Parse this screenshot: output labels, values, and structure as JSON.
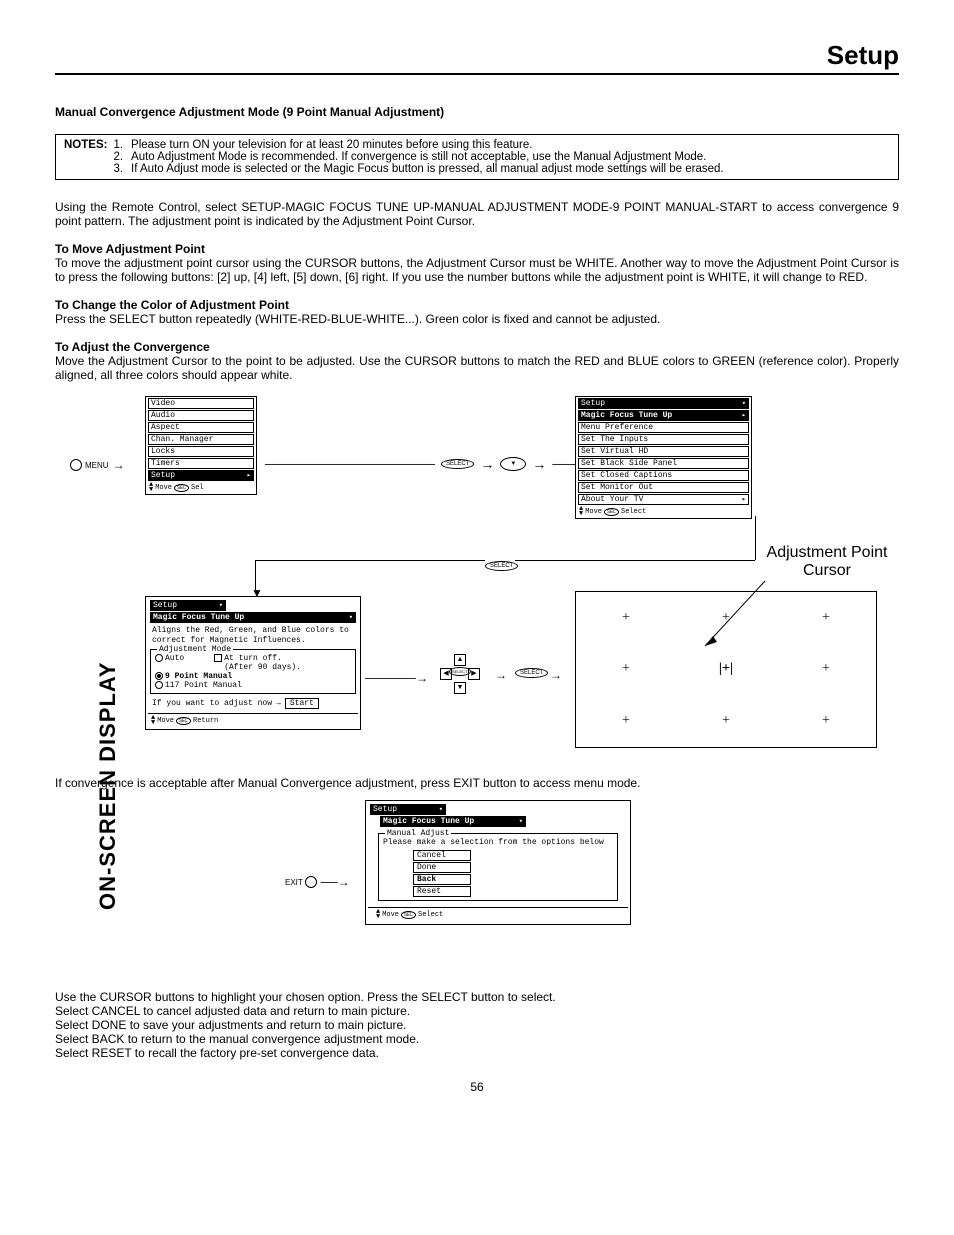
{
  "header": {
    "title": "Setup"
  },
  "vertical": "ON-SCREEN DISPLAY",
  "pageNumber": "56",
  "section": {
    "title": "Manual Convergence Adjustment Mode (9 Point Manual Adjustment)"
  },
  "notes": {
    "label": "NOTES:",
    "items": [
      "Please turn ON your television for at least 20 minutes before using this feature.",
      "Auto Adjustment Mode is recommended.  If convergence is still not acceptable, use the Manual Adjustment Mode.",
      "If Auto Adjust mode is selected or the Magic Focus button is pressed, all manual adjust mode settings will be erased."
    ]
  },
  "intro": "Using the Remote Control, select SETUP-MAGIC FOCUS TUNE UP-MANUAL ADJUSTMENT MODE-9 POINT MANUAL-START to access convergence 9 point  pattern.  The adjustment point is indicated by the Adjustment Point Cursor.",
  "move": {
    "title": "To Move Adjustment Point",
    "body": "To move the adjustment point cursor using the CURSOR buttons, the Adjustment Cursor must be WHITE.  Another way to move the Adjustment Point Cursor is to press the following buttons:  [2] up, [4] left, [5] down, [6] right.  If you use the number buttons while the adjustment point is WHITE, it will change to RED."
  },
  "color": {
    "title": "To Change the Color of Adjustment Point",
    "body": "Press the SELECT button repeatedly (WHITE-RED-BLUE-WHITE...).  Green color is fixed and cannot be adjusted."
  },
  "adjust": {
    "title": "To Adjust the Convergence",
    "body": "Move the Adjustment Cursor to the point to be adjusted.  Use the CURSOR buttons to match the RED and BLUE colors to GREEN (reference color).  Properly aligned, all three colors should appear white."
  },
  "menu1": {
    "items": [
      "Video",
      "Audio",
      "Aspect",
      "Chan. Manager",
      "Locks",
      "Timers",
      "Setup"
    ],
    "highlight": "Setup",
    "footer": "Move",
    "footerBtn": "SEL",
    "footerAction": "Sel"
  },
  "menuLabel": "MENU",
  "btns": {
    "select": "SELECT",
    "exit": "EXIT"
  },
  "menu2": {
    "header": "Setup",
    "items": [
      "Magic Focus Tune Up",
      "Menu Preference",
      "Set The Inputs",
      "Set Virtual HD",
      "Set Black Side Panel",
      "Set Closed Captions",
      "Set Monitor Out",
      "About Your TV"
    ],
    "highlight": "Magic Focus Tune Up",
    "footer": "Move",
    "footerBtn": "SEL",
    "footerAction": "Select"
  },
  "cursorLabel": "Adjustment Point Cursor",
  "menu3": {
    "header": "Setup",
    "sub": "Magic Focus Tune Up",
    "desc": "Aligns the Red, Green, and Blue colors to correct for Magnetic Influences.",
    "legend": "Adjustment Mode",
    "opt1": "Auto",
    "opt1b": "At turn off.",
    "opt1c": "(After 90 days).",
    "opt2": "9 Point Manual",
    "opt3": "117 Point Manual",
    "prompt": "If you want to adjust now",
    "start": "Start",
    "footer": "Move",
    "footerBtn": "SEL",
    "footerAction": "Return"
  },
  "postDiagram": "If convergence is acceptable after Manual Convergence adjustment, press EXIT button to access menu mode.",
  "menu4": {
    "header": "Setup",
    "sub": "Magic Focus Tune Up",
    "legend": "Manual Adjust",
    "prompt": "Please make a selection from the options below",
    "opts": [
      "Cancel",
      "Done",
      "Back",
      "Reset"
    ],
    "highlight": "Back",
    "footer": "Move",
    "footerBtn": "SEL",
    "footerAction": "Select"
  },
  "trailing": [
    "Use the CURSOR buttons to highlight your chosen option.  Press the SELECT button to select.",
    "Select CANCEL to cancel adjusted data and return to main picture.",
    "Select DONE to save your adjustments and return to main picture.",
    "Select BACK to return to the manual convergence adjustment mode.",
    "Select RESET to recall the factory pre-set convergence data."
  ]
}
